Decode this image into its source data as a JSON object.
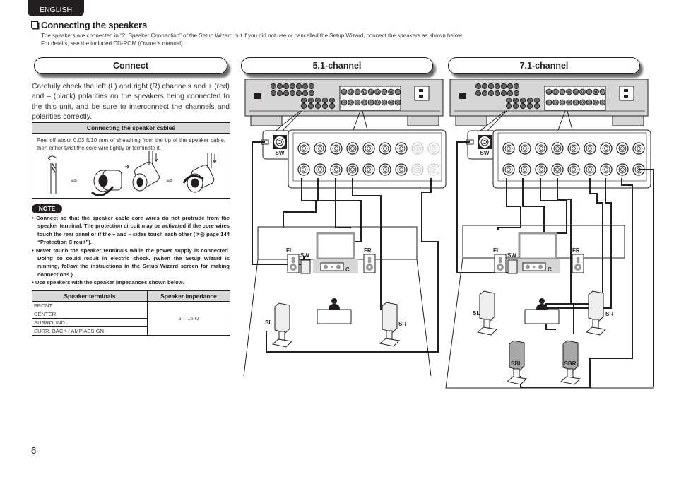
{
  "header": {
    "language_tab": "ENGLISH"
  },
  "section": {
    "title": "Connecting the speakers",
    "intro_line1": "The speakers are connected in “2. Speaker Connection” of the Setup Wizard but if you did not use or cancelled the Setup Wizard, connect the speakers as shown below.",
    "intro_line2": "For details, see the included CD-ROM (Owner’s manual)."
  },
  "connect": {
    "heading": "Connect",
    "body": "Carefully check the left (L) and right (R) channels and + (red) and – (black) polarities on the speakers being connected to the this unit, and be sure to interconnect the channels and polarities correctly.",
    "cable_box": {
      "title": "Connecting the speaker cables",
      "text": "Peel off about 0.03 ft/10 mm of sheathing from the tip of the speaker cable, then either twist the core wire tightly or terminate it."
    },
    "note_label": "NOTE",
    "notes": [
      "Connect so that the speaker cable core wires do not protrude from the speaker terminal. The protection circuit may be activated if the core wires touch the rear panel or if the + and – sides touch each other (☞◎ page 144 “Protection Circuit”).",
      "Never touch the speaker terminals while the power supply is connected. Doing so could result in electric shock. (When the Setup Wizard is running, follow the instructions in the Setup Wizard screen for making connections.)",
      "Use speakers with the speaker impedances shown below."
    ],
    "impedance_table": {
      "headers": [
        "Speaker terminals",
        "Speaker impedance"
      ],
      "terminals": [
        "FRONT",
        "CENTER",
        "SURROUND",
        "SURR. BACK / AMP ASSIGN"
      ],
      "impedance": "6 – 16 Ω"
    }
  },
  "diagram_51": {
    "heading": "5.1-channel",
    "labels": {
      "fl": "FL",
      "sw": "SW",
      "fr": "FR",
      "c": "C",
      "sl": "SL",
      "sr": "SR",
      "sw_jack": "SW"
    }
  },
  "diagram_71": {
    "heading": "7.1-channel",
    "labels": {
      "fl": "FL",
      "sw": "SW",
      "fr": "FR",
      "c": "C",
      "sl": "SL",
      "sr": "SR",
      "sbl": "SBL",
      "sbr": "SBR",
      "sw_jack": "SW"
    }
  },
  "footer": {
    "page_number": "6"
  }
}
